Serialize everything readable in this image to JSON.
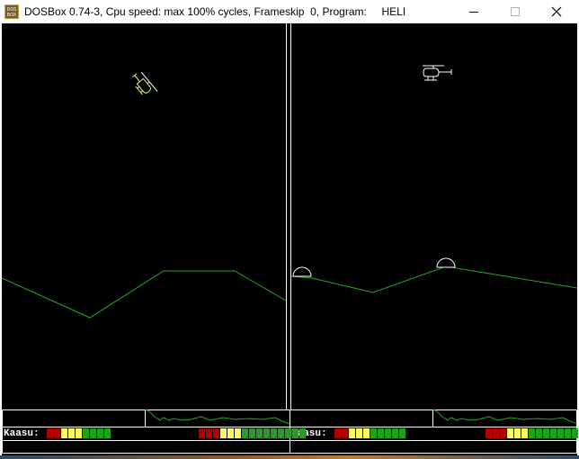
{
  "window": {
    "title": "DOSBox 0.74-3, Cpu speed: max 100% cycles, Frameskip  0, Program:     HELI",
    "icon_name": "dosbox-icon",
    "icon_text_top": "DOS",
    "icon_text_bottom": "BOX",
    "controls": [
      "minimize-icon",
      "maximize-icon",
      "close-icon"
    ]
  },
  "game": {
    "name": "HELI",
    "colors": {
      "background": "#000000",
      "terrain": "#22aa22",
      "frame": "#ffffff",
      "heli_left": "#f2f27a",
      "heli_right": "#ffffff",
      "gauge_red": "#b00000",
      "gauge_yellow": "#ffff66",
      "gauge_green": "#1fa01f"
    },
    "players": [
      {
        "id": "left",
        "fuel_label": "Kaasu:",
        "fuel_gauge_a": [
          "red",
          "red",
          "yellow",
          "yellow",
          "yellow",
          "green",
          "green",
          "green",
          "green"
        ],
        "fuel_gauge_b": [
          "red",
          "red",
          "red",
          "yellow",
          "yellow",
          "yellow",
          "green",
          "green",
          "green",
          "green",
          "green",
          "green",
          "green",
          "green",
          "green"
        ]
      },
      {
        "id": "right",
        "fuel_label": "Kaasu:",
        "fuel_gauge_a": [
          "red",
          "red",
          "yellow",
          "yellow",
          "yellow",
          "green",
          "green",
          "green",
          "green",
          "green"
        ],
        "fuel_gauge_b": [
          "red",
          "red",
          "red",
          "yellow",
          "yellow",
          "yellow",
          "green",
          "green",
          "green",
          "green",
          "green",
          "green",
          "green",
          "grey"
        ]
      }
    ]
  }
}
